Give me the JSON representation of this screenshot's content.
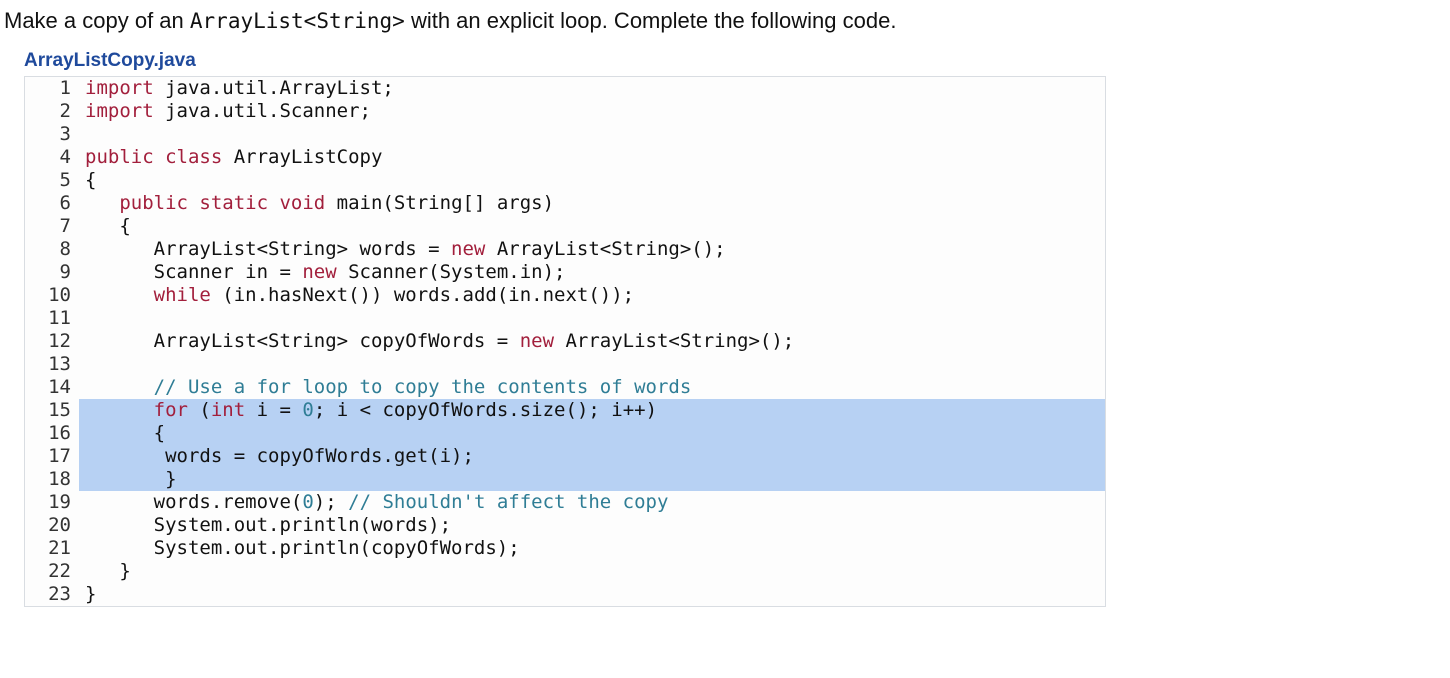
{
  "prompt_pre": "Make a copy of an ",
  "prompt_mono": "ArrayList<String>",
  "prompt_post": " with an explicit loop. Complete the following code.",
  "filename": "ArrayListCopy.java",
  "code": {
    "highlight_start": 15,
    "highlight_end": 18,
    "lines": [
      {
        "n": 1,
        "tokens": [
          {
            "t": "import",
            "c": "kw"
          },
          {
            "t": " java.util.ArrayList;",
            "c": "id"
          }
        ]
      },
      {
        "n": 2,
        "tokens": [
          {
            "t": "import",
            "c": "kw"
          },
          {
            "t": " java.util.Scanner;",
            "c": "id"
          }
        ]
      },
      {
        "n": 3,
        "tokens": [
          {
            "t": "",
            "c": "id"
          }
        ]
      },
      {
        "n": 4,
        "tokens": [
          {
            "t": "public class",
            "c": "kw"
          },
          {
            "t": " ArrayListCopy",
            "c": "id"
          }
        ]
      },
      {
        "n": 5,
        "tokens": [
          {
            "t": "{",
            "c": "id"
          }
        ]
      },
      {
        "n": 6,
        "tokens": [
          {
            "t": "   ",
            "c": "id"
          },
          {
            "t": "public static void",
            "c": "kw"
          },
          {
            "t": " main(String[] args)",
            "c": "id"
          }
        ]
      },
      {
        "n": 7,
        "tokens": [
          {
            "t": "   {",
            "c": "id"
          }
        ]
      },
      {
        "n": 8,
        "tokens": [
          {
            "t": "      ArrayList<String> words = ",
            "c": "id"
          },
          {
            "t": "new",
            "c": "kw"
          },
          {
            "t": " ArrayList<String>();",
            "c": "id"
          }
        ]
      },
      {
        "n": 9,
        "tokens": [
          {
            "t": "      Scanner in = ",
            "c": "id"
          },
          {
            "t": "new",
            "c": "kw"
          },
          {
            "t": " Scanner(System.in);",
            "c": "id"
          }
        ]
      },
      {
        "n": 10,
        "tokens": [
          {
            "t": "      ",
            "c": "id"
          },
          {
            "t": "while",
            "c": "kw"
          },
          {
            "t": " (in.hasNext()) words.add(in.next());",
            "c": "id"
          }
        ]
      },
      {
        "n": 11,
        "tokens": [
          {
            "t": "",
            "c": "id"
          }
        ]
      },
      {
        "n": 12,
        "tokens": [
          {
            "t": "      ArrayList<String> copyOfWords = ",
            "c": "id"
          },
          {
            "t": "new",
            "c": "kw"
          },
          {
            "t": " ArrayList<String>();",
            "c": "id"
          }
        ]
      },
      {
        "n": 13,
        "tokens": [
          {
            "t": "",
            "c": "id"
          }
        ]
      },
      {
        "n": 14,
        "tokens": [
          {
            "t": "      ",
            "c": "id"
          },
          {
            "t": "// Use a for loop to copy the contents of words",
            "c": "cmt"
          }
        ]
      },
      {
        "n": 15,
        "tokens": [
          {
            "t": "      ",
            "c": "id"
          },
          {
            "t": "for",
            "c": "kw"
          },
          {
            "t": " (",
            "c": "id"
          },
          {
            "t": "int",
            "c": "kw"
          },
          {
            "t": " i = ",
            "c": "id"
          },
          {
            "t": "0",
            "c": "num"
          },
          {
            "t": "; i < copyOfWords.size(); i++)",
            "c": "id"
          }
        ]
      },
      {
        "n": 16,
        "tokens": [
          {
            "t": "      {",
            "c": "id"
          }
        ]
      },
      {
        "n": 17,
        "tokens": [
          {
            "t": "       words = copyOfWords.get(i);",
            "c": "id"
          }
        ]
      },
      {
        "n": 18,
        "tokens": [
          {
            "t": "       }",
            "c": "id"
          }
        ]
      },
      {
        "n": 19,
        "tokens": [
          {
            "t": "      words.remove(",
            "c": "id"
          },
          {
            "t": "0",
            "c": "num"
          },
          {
            "t": "); ",
            "c": "id"
          },
          {
            "t": "// Shouldn't affect the copy",
            "c": "cmt"
          }
        ]
      },
      {
        "n": 20,
        "tokens": [
          {
            "t": "      System.out.println(words);",
            "c": "id"
          }
        ]
      },
      {
        "n": 21,
        "tokens": [
          {
            "t": "      System.out.println(copyOfWords);",
            "c": "id"
          }
        ]
      },
      {
        "n": 22,
        "tokens": [
          {
            "t": "   }",
            "c": "id"
          }
        ]
      },
      {
        "n": 23,
        "tokens": [
          {
            "t": "}",
            "c": "id"
          }
        ]
      }
    ]
  }
}
